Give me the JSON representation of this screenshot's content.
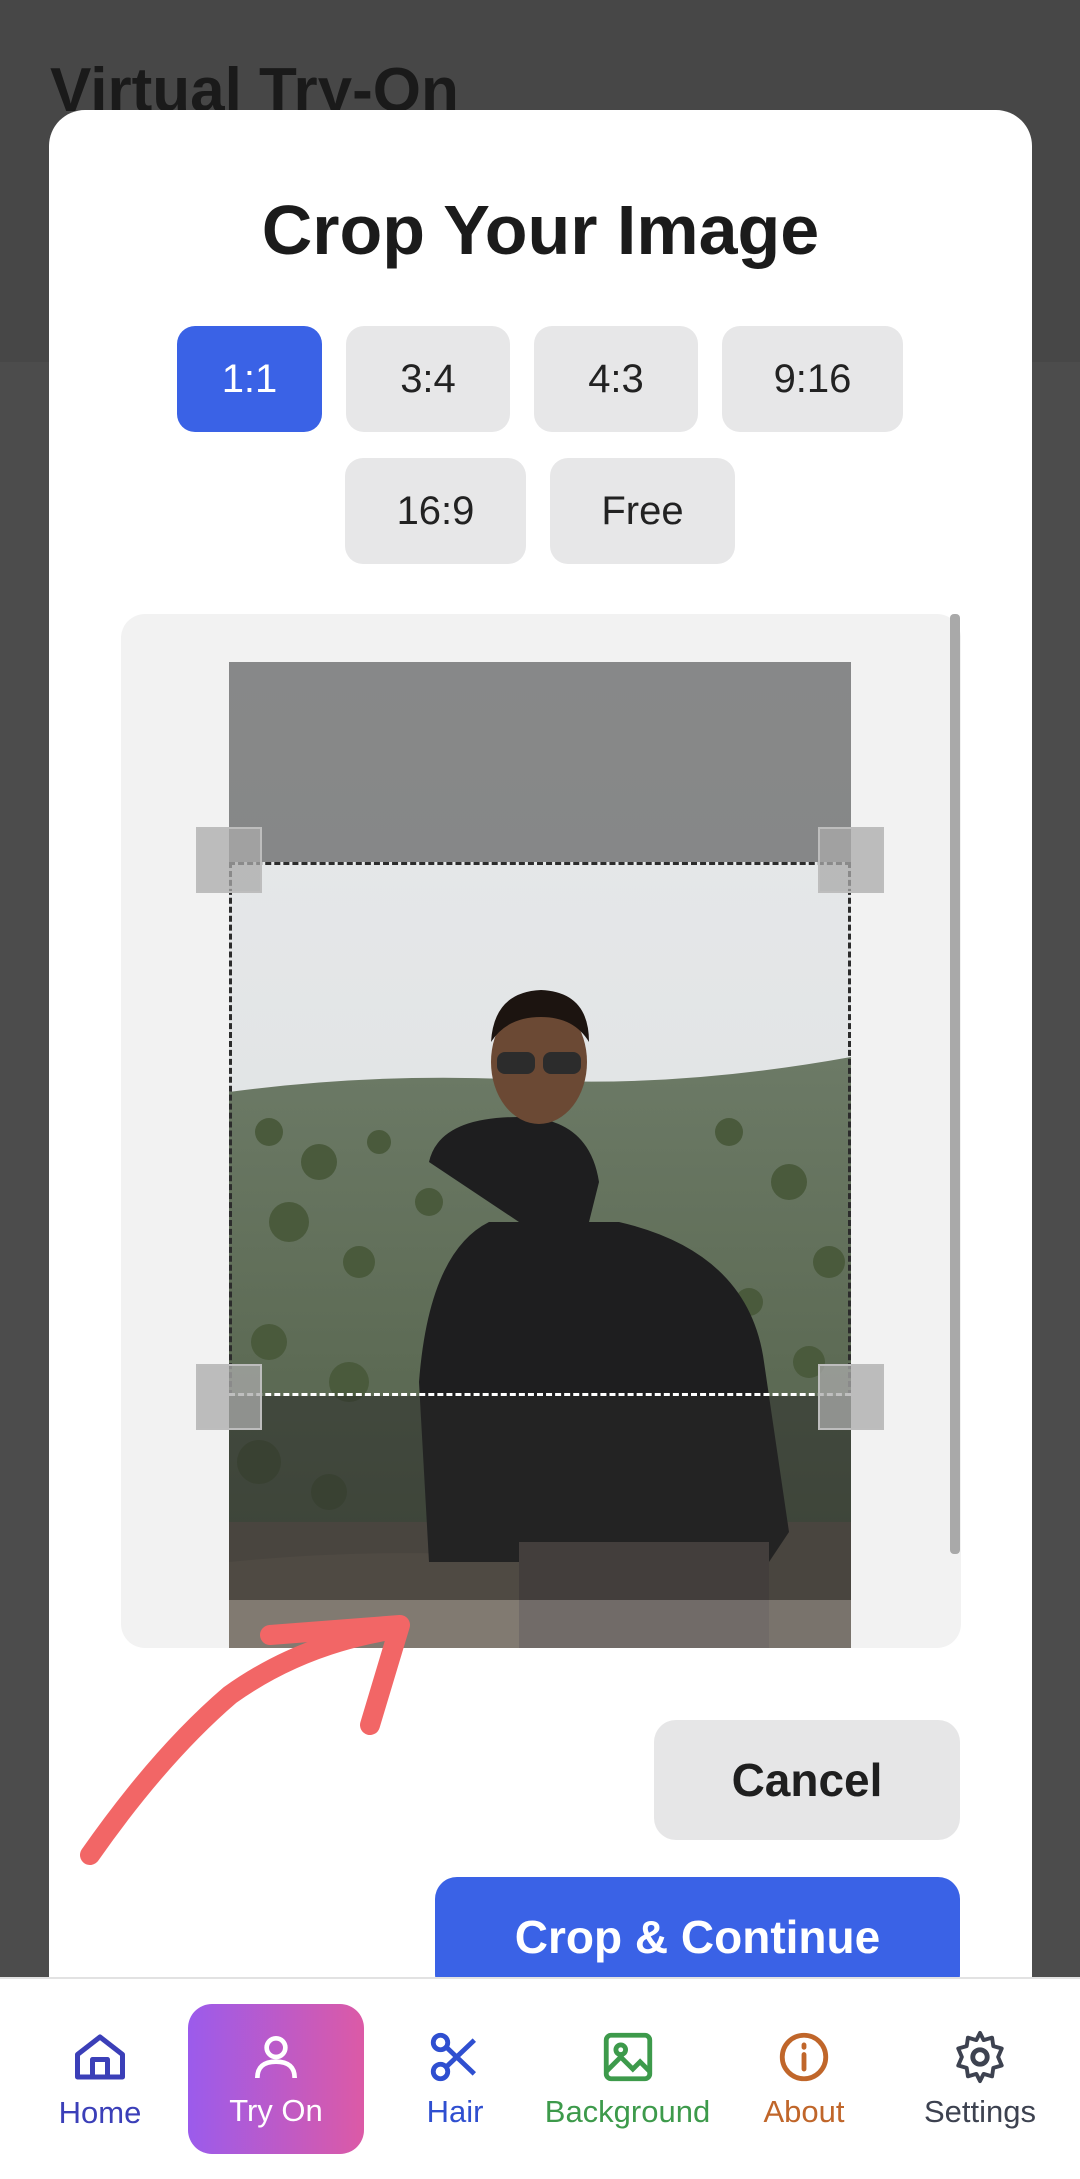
{
  "background": {
    "title": "Virtual Try-On"
  },
  "modal": {
    "title": "Crop Your Image",
    "ratios": [
      {
        "label": "1:1",
        "active": true
      },
      {
        "label": "3:4",
        "active": false
      },
      {
        "label": "4:3",
        "active": false
      },
      {
        "label": "9:16",
        "active": false
      },
      {
        "label": "16:9",
        "active": false
      },
      {
        "label": "Free",
        "active": false
      }
    ],
    "cancel_label": "Cancel",
    "crop_label": "Crop & Continue"
  },
  "nav": {
    "items": [
      {
        "label": "Home",
        "icon": "home-icon",
        "color": "#3b3fb8"
      },
      {
        "label": "Try On",
        "icon": "user-icon",
        "color": "#ffffff",
        "active": true
      },
      {
        "label": "Hair",
        "icon": "scissors-icon",
        "color": "#2f4fd0"
      },
      {
        "label": "Background",
        "icon": "image-icon",
        "color": "#3d9a4b"
      },
      {
        "label": "About",
        "icon": "info-icon",
        "color": "#c0662a"
      },
      {
        "label": "Settings",
        "icon": "gear-icon",
        "color": "#3d4250"
      }
    ]
  },
  "colors": {
    "primary": "#3a62e6",
    "annotation_arrow": "#f26666"
  }
}
